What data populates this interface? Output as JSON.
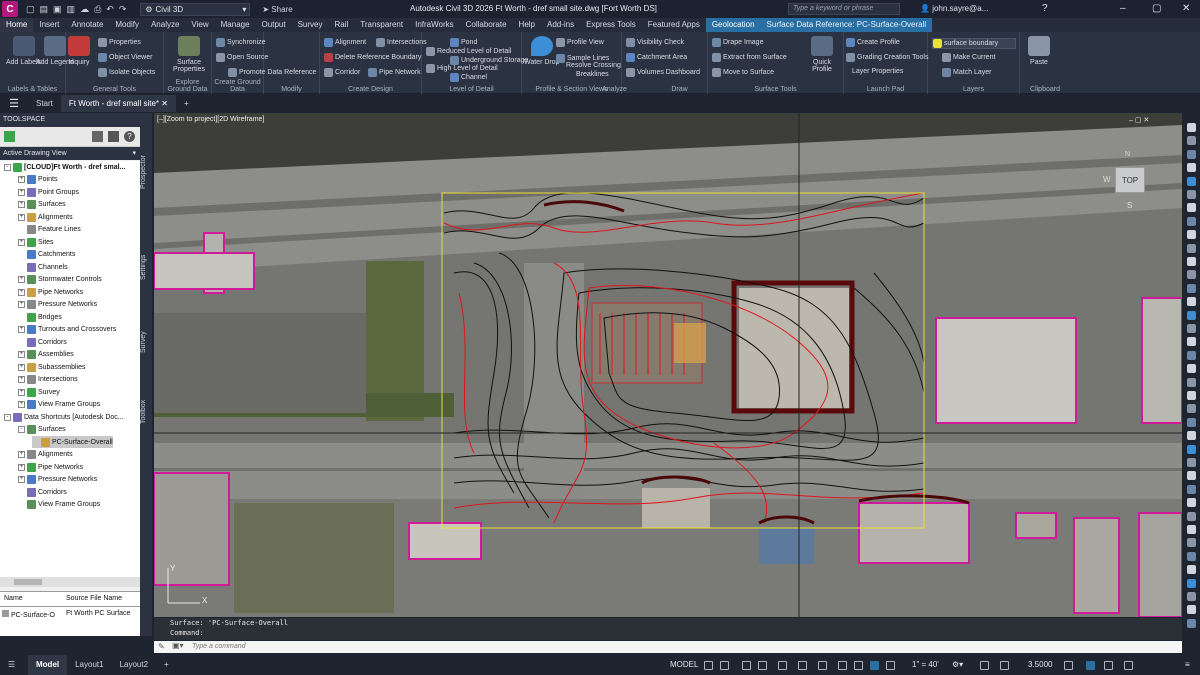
{
  "titlebar": {
    "app_letter": "C",
    "workspace": "Civil 3D",
    "share_label": "Share",
    "doc_title": "Autodesk Civil 3D 2026   Ft Worth - dref small site.dwg [Fort Worth DS]",
    "search_placeholder": "Type a keyword or phrase",
    "user": "john.sayre@a..."
  },
  "ribbon_tabs": [
    "Home",
    "Insert",
    "Annotate",
    "Modify",
    "Analyze",
    "View",
    "Manage",
    "Output",
    "Survey",
    "Rail",
    "Transparent",
    "InfraWorks",
    "Collaborate",
    "Help",
    "Add-ins",
    "Express Tools",
    "Featured Apps",
    "Geolocation",
    "Surface Data Reference: PC-Surface-Overall"
  ],
  "ribbon": {
    "labels_group": {
      "label": "Labels & Tables",
      "add_labels": "Add Labels",
      "add_legend": "Add Legend"
    },
    "general_tools": {
      "label": "General Tools",
      "properties": "Properties",
      "inquiry": "Inquiry",
      "object_viewer": "Object Viewer",
      "isolate": "Isolate Objects"
    },
    "explore_ground": {
      "label": "Explore Ground Data",
      "surface_properties": "Surface Properties"
    },
    "create_ground": {
      "label": "Create Ground Data",
      "open_source": "Open Source"
    },
    "modify": {
      "label": "Modify",
      "sync_source": "Synchronize",
      "promote": "Promote Data Reference",
      "delete_ref": "Delete Reference Boundary"
    },
    "create_design": {
      "label": "Create Design",
      "alignment": "Alignment",
      "intersections": "Intersections",
      "pipe_network": "Pipe Network",
      "corridor": "Corridor"
    },
    "level_of_detail": {
      "label": "Level of Detail",
      "pond": "Pond",
      "reduced": "Reduced Level of Detail",
      "underground": "Underground Storage",
      "high": "High Level of Detail",
      "channel": "Channel"
    },
    "profile_section": {
      "label": "Profile & Section Views",
      "profile_view": "Profile View",
      "water_drop": "Water Drop",
      "sample_lines": "Sample Lines",
      "resolve": "Resolve Crossing",
      "breaklines": "Breaklines"
    },
    "analyze": {
      "label": "Analyze",
      "visibility": "Visibility Check",
      "catchment": "Catchment Area",
      "volumes": "Volumes Dashboard"
    },
    "draw": {
      "label": "Draw"
    },
    "surface_tools": {
      "label": "Surface Tools",
      "drape": "Drape Image",
      "extract": "Extract from Surface",
      "move": "Move to Surface",
      "quick_profile": "Quick Profile"
    },
    "launch_pad": {
      "label": "Launch Pad",
      "create_profile": "Create Profile",
      "grading": "Grading Creation Tools",
      "layer_props": "Layer Properties"
    },
    "layers": {
      "label": "Layers",
      "layer_name": "surface boundary",
      "make_current": "Make Current",
      "match_layer": "Match Layer"
    },
    "clipboard": {
      "label": "Clipboard",
      "paste": "Paste"
    }
  },
  "doc_tabs": {
    "start": "Start",
    "active": "Ft Worth - dref small site*"
  },
  "toolspace": {
    "title": "TOOLSPACE",
    "view": "Active Drawing View",
    "vtabs": [
      "Prospector",
      "Settings",
      "Survey",
      "Toolbox"
    ],
    "tree": [
      {
        "label": "[CLOUD]Ft Worth - dref smal...",
        "level": 0,
        "exp": "-",
        "bold": true
      },
      {
        "label": "Points",
        "level": 1,
        "exp": "+"
      },
      {
        "label": "Point Groups",
        "level": 1,
        "exp": "+"
      },
      {
        "label": "Surfaces",
        "level": 1,
        "exp": "+"
      },
      {
        "label": "Alignments",
        "level": 1,
        "exp": "+"
      },
      {
        "label": "Feature Lines",
        "level": 1,
        "exp": ""
      },
      {
        "label": "Sites",
        "level": 1,
        "exp": "+"
      },
      {
        "label": "Catchments",
        "level": 1,
        "exp": ""
      },
      {
        "label": "Channels",
        "level": 1,
        "exp": ""
      },
      {
        "label": "Stormwater Controls",
        "level": 1,
        "exp": "+"
      },
      {
        "label": "Pipe Networks",
        "level": 1,
        "exp": "+"
      },
      {
        "label": "Pressure Networks",
        "level": 1,
        "exp": "+"
      },
      {
        "label": "Bridges",
        "level": 1,
        "exp": ""
      },
      {
        "label": "Turnouts and Crossovers",
        "level": 1,
        "exp": "+"
      },
      {
        "label": "Corridors",
        "level": 1,
        "exp": ""
      },
      {
        "label": "Assemblies",
        "level": 1,
        "exp": "+"
      },
      {
        "label": "Subassemblies",
        "level": 1,
        "exp": "+"
      },
      {
        "label": "Intersections",
        "level": 1,
        "exp": "+"
      },
      {
        "label": "Survey",
        "level": 1,
        "exp": "+"
      },
      {
        "label": "View Frame Groups",
        "level": 1,
        "exp": "+"
      },
      {
        "label": "Data Shortcuts [Autodesk Doc...",
        "level": 0,
        "exp": "-"
      },
      {
        "label": "Surfaces",
        "level": 1,
        "exp": "-"
      },
      {
        "label": "PC-Surface-Overall",
        "level": 2,
        "exp": "",
        "selected": true
      },
      {
        "label": "Alignments",
        "level": 1,
        "exp": "+"
      },
      {
        "label": "Pipe Networks",
        "level": 1,
        "exp": "+"
      },
      {
        "label": "Pressure Networks",
        "level": 1,
        "exp": "+"
      },
      {
        "label": "Corridors",
        "level": 1,
        "exp": ""
      },
      {
        "label": "View Frame Groups",
        "level": 1,
        "exp": ""
      }
    ],
    "grid": {
      "headers": [
        "Name",
        "Source File Name"
      ],
      "row": [
        "PC-Surface-O",
        "Ft Worth PC Surface"
      ]
    }
  },
  "viewport": {
    "label": "[–][Zoom to project][2D Wireframe]",
    "viewcube_top": "TOP",
    "viewcube_w": "W",
    "viewcube_s": "S",
    "viewcube_n": "N",
    "ucs_x": "X",
    "ucs_y": "Y"
  },
  "command": {
    "line1": "Surface: 'PC-Surface-Overall",
    "line2": "Command:",
    "placeholder": "Type a command"
  },
  "statusbar": {
    "tabs": [
      "Model",
      "Layout1",
      "Layout2"
    ],
    "model_label": "MODEL",
    "scale": "1\" = 40'",
    "value": "3.5000"
  },
  "colors": {
    "accent": "#2a6fa3",
    "magenta_boundary": "#d01a9a",
    "contour_red": "#e0151b",
    "contour_black": "#111111",
    "selection_yellow": "#e8e233"
  }
}
